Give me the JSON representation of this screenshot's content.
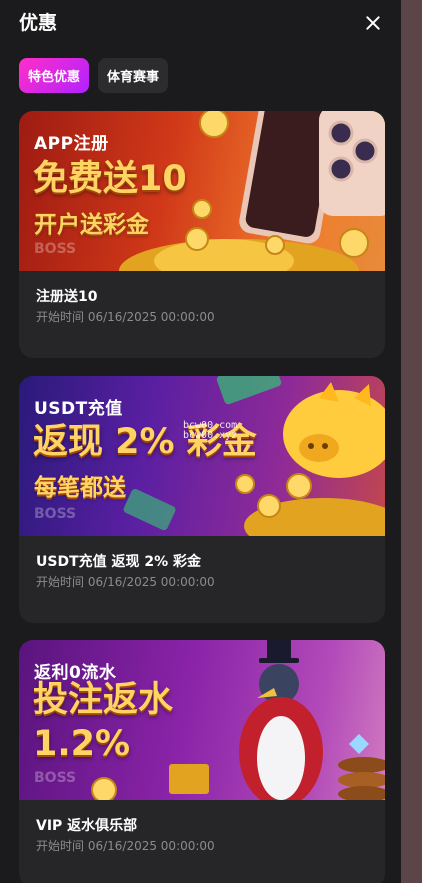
{
  "header": {
    "title": "优惠"
  },
  "tabs": [
    {
      "label": "特色优惠",
      "active": true
    },
    {
      "label": "体育赛事",
      "active": false
    }
  ],
  "promos": [
    {
      "tag": "APP注册",
      "headline": "免费送10",
      "subline": "开户送彩金",
      "brand": "BOSS",
      "title": "注册送10",
      "date": "开始时间 06/16/2025 00:00:00"
    },
    {
      "tag": "USDT充值",
      "headline": "返现 2% 彩金",
      "subline": "每笔都送",
      "brand": "BOSS",
      "watermark_1": "bcw00.com",
      "watermark_2": "bcw00.xyz",
      "title": "USDT充值 返现 2% 彩金",
      "date": "开始时间 06/16/2025 00:00:00"
    },
    {
      "tag": "返利0流水",
      "headline": "投注返水",
      "subline": "1.2%",
      "brand": "BOSS",
      "title": "VIP 返水俱乐部",
      "date": "开始时间 06/16/2025 00:00:00"
    }
  ],
  "colors": {
    "panel_bg": "#1b1b1d",
    "card_bg": "#262628",
    "active_tab": "#d326e6",
    "headline_gold": "#ffd463"
  },
  "icons": [
    "close-icon"
  ]
}
